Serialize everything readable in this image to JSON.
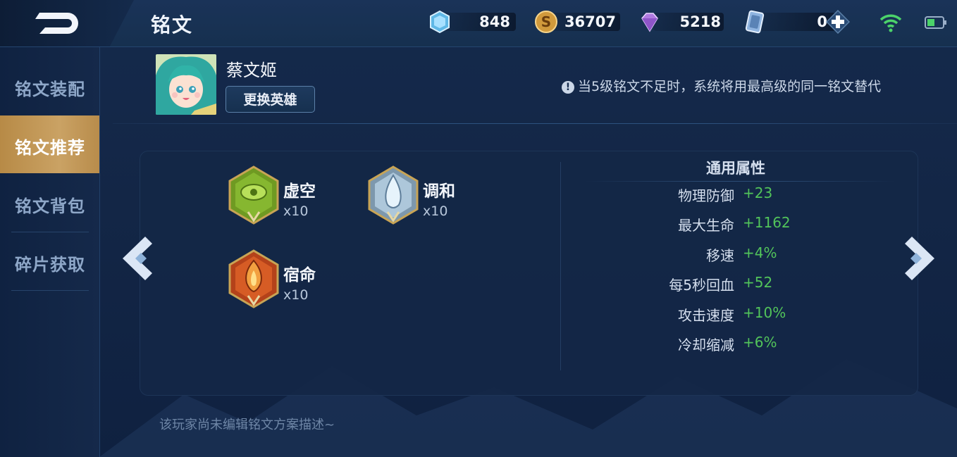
{
  "header": {
    "title": "铭文",
    "currencies": [
      {
        "icon": "crystal-icon",
        "value": "848"
      },
      {
        "icon": "gold-coin-icon",
        "value": "36707"
      },
      {
        "icon": "diamond-icon",
        "value": "5218"
      },
      {
        "icon": "ticket-card-icon",
        "value": "0"
      }
    ],
    "add_icon": "plus-icon",
    "wifi_icon": "wifi-icon",
    "battery_icon": "battery-icon"
  },
  "sidebar": {
    "items": [
      {
        "label": "铭文装配",
        "active": false
      },
      {
        "label": "铭文推荐",
        "active": true
      },
      {
        "label": "铭文背包",
        "active": false
      },
      {
        "label": "碎片获取",
        "active": false
      }
    ]
  },
  "hero": {
    "name": "蔡文姬",
    "change_button": "更换英雄"
  },
  "notice": "当5级铭文不足时，系统将用最高级的同一铭文替代",
  "runes": [
    {
      "name": "虚空",
      "count": "x10",
      "color": "#7fae2c"
    },
    {
      "name": "调和",
      "count": "x10",
      "color": "#9cc3e0"
    },
    {
      "name": "宿命",
      "count": "x10",
      "color": "#d2571f"
    }
  ],
  "stats": {
    "title": "通用属性",
    "rows": [
      {
        "label": "物理防御",
        "value": "+23"
      },
      {
        "label": "最大生命",
        "value": "+1162"
      },
      {
        "label": "移速",
        "value": "+4%"
      },
      {
        "label": "每5秒回血",
        "value": "+52"
      },
      {
        "label": "攻击速度",
        "value": "+10%"
      },
      {
        "label": "冷却缩减",
        "value": "+6%"
      }
    ]
  },
  "footer": {
    "description": "该玩家尚未编辑铭文方案描述~"
  },
  "colors": {
    "accent_gold": "#c49a5a",
    "stat_green": "#52c45a",
    "background": "#11223f"
  }
}
